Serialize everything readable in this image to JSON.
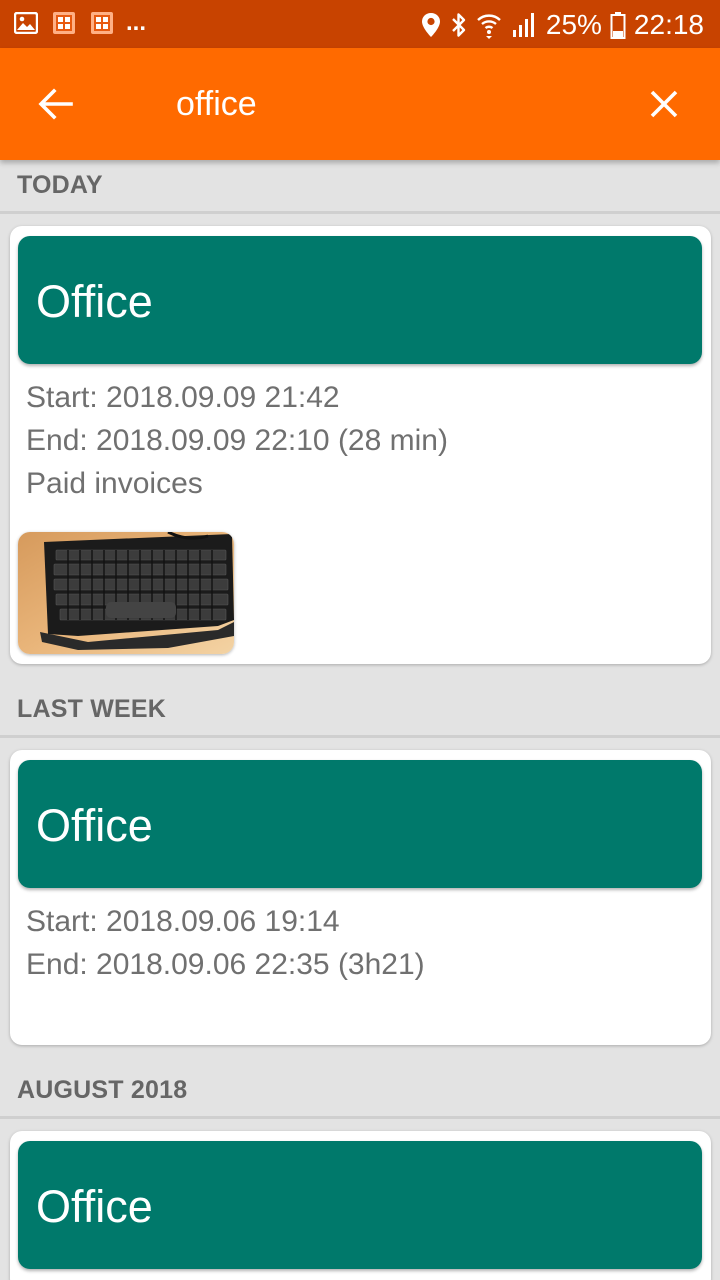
{
  "status_bar": {
    "overflow": "...",
    "battery": "25%",
    "time": "22:18"
  },
  "app_bar": {
    "search_value": "office",
    "back_icon": "arrow-back-icon",
    "close_icon": "close-icon",
    "color": "#ff6a00"
  },
  "sections": [
    {
      "header": "TODAY",
      "cards": [
        {
          "title": "Office",
          "start": "Start: 2018.09.09 21:42",
          "end": "End: 2018.09.09 22:10 (28 min)",
          "note": "Paid invoices",
          "has_photo": true
        }
      ]
    },
    {
      "header": "LAST WEEK",
      "cards": [
        {
          "title": "Office",
          "start": "Start: 2018.09.06 19:14",
          "end": "End: 2018.09.06 22:35 (3h21)"
        }
      ]
    },
    {
      "header": "AUGUST 2018",
      "cards": [
        {
          "title": "Office"
        }
      ]
    }
  ],
  "colors": {
    "status_bar": "#c84300",
    "accent": "#ff6a00",
    "card_banner": "#00796b"
  }
}
